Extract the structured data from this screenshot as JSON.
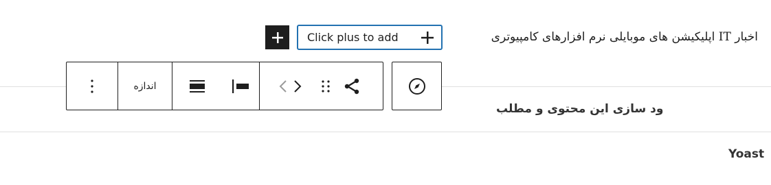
{
  "category_line": "اخبار IT  اپلیکیشن های موبایلی  نرم افزارهای کامپیوتری",
  "inserter": {
    "placeholder_label": "Click plus to add",
    "plus_icon": "plus-icon",
    "appender_icon": "plus-icon"
  },
  "block_toolbar": {
    "size_label": "اندازه",
    "icons": [
      "more-vertical-icon",
      "justify-fill-icon",
      "justify-left-icon",
      "chevron-left-icon",
      "chevron-right-icon",
      "drag-handle-icon",
      "share-icon"
    ]
  },
  "parent_selector_icon": "compass-icon",
  "metabox": {
    "title": "ود سازی این محتوی و مطلب",
    "yoast_title": "Yoast"
  },
  "colors": {
    "focus_border": "#2271b1",
    "text": "#1e1e1e"
  }
}
